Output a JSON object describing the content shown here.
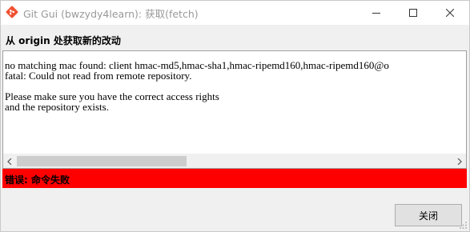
{
  "window": {
    "title": "Git Gui (bwzydy4learn): 获取(fetch)",
    "app_icon": "git-diamond-icon",
    "controls": [
      "minimize-icon",
      "maximize-icon",
      "close-icon"
    ]
  },
  "heading": "从 origin 处获取新的改动",
  "output": {
    "text": "no matching mac found: client hmac-md5,hmac-sha1,hmac-ripemd160,hmac-ripemd160@o\nfatal: Could not read from remote repository.\n\nPlease make sure you have the correct access rights\nand the repository exists."
  },
  "status": {
    "text": "错误: 命令失败",
    "color": "#ff0000"
  },
  "buttons": {
    "close_label": "关闭"
  },
  "colors": {
    "git_icon": "#f05133",
    "status_background": "#ff0000"
  }
}
